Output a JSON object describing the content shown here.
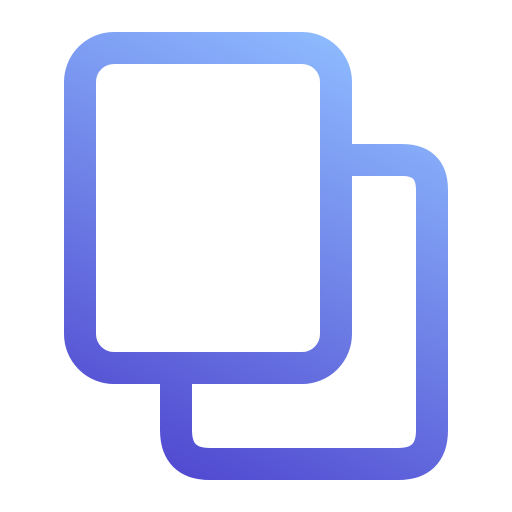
{
  "icon": {
    "name": "copy-icon",
    "gradient": {
      "start_color": "#8ebcff",
      "end_color": "#4f46cf"
    }
  }
}
